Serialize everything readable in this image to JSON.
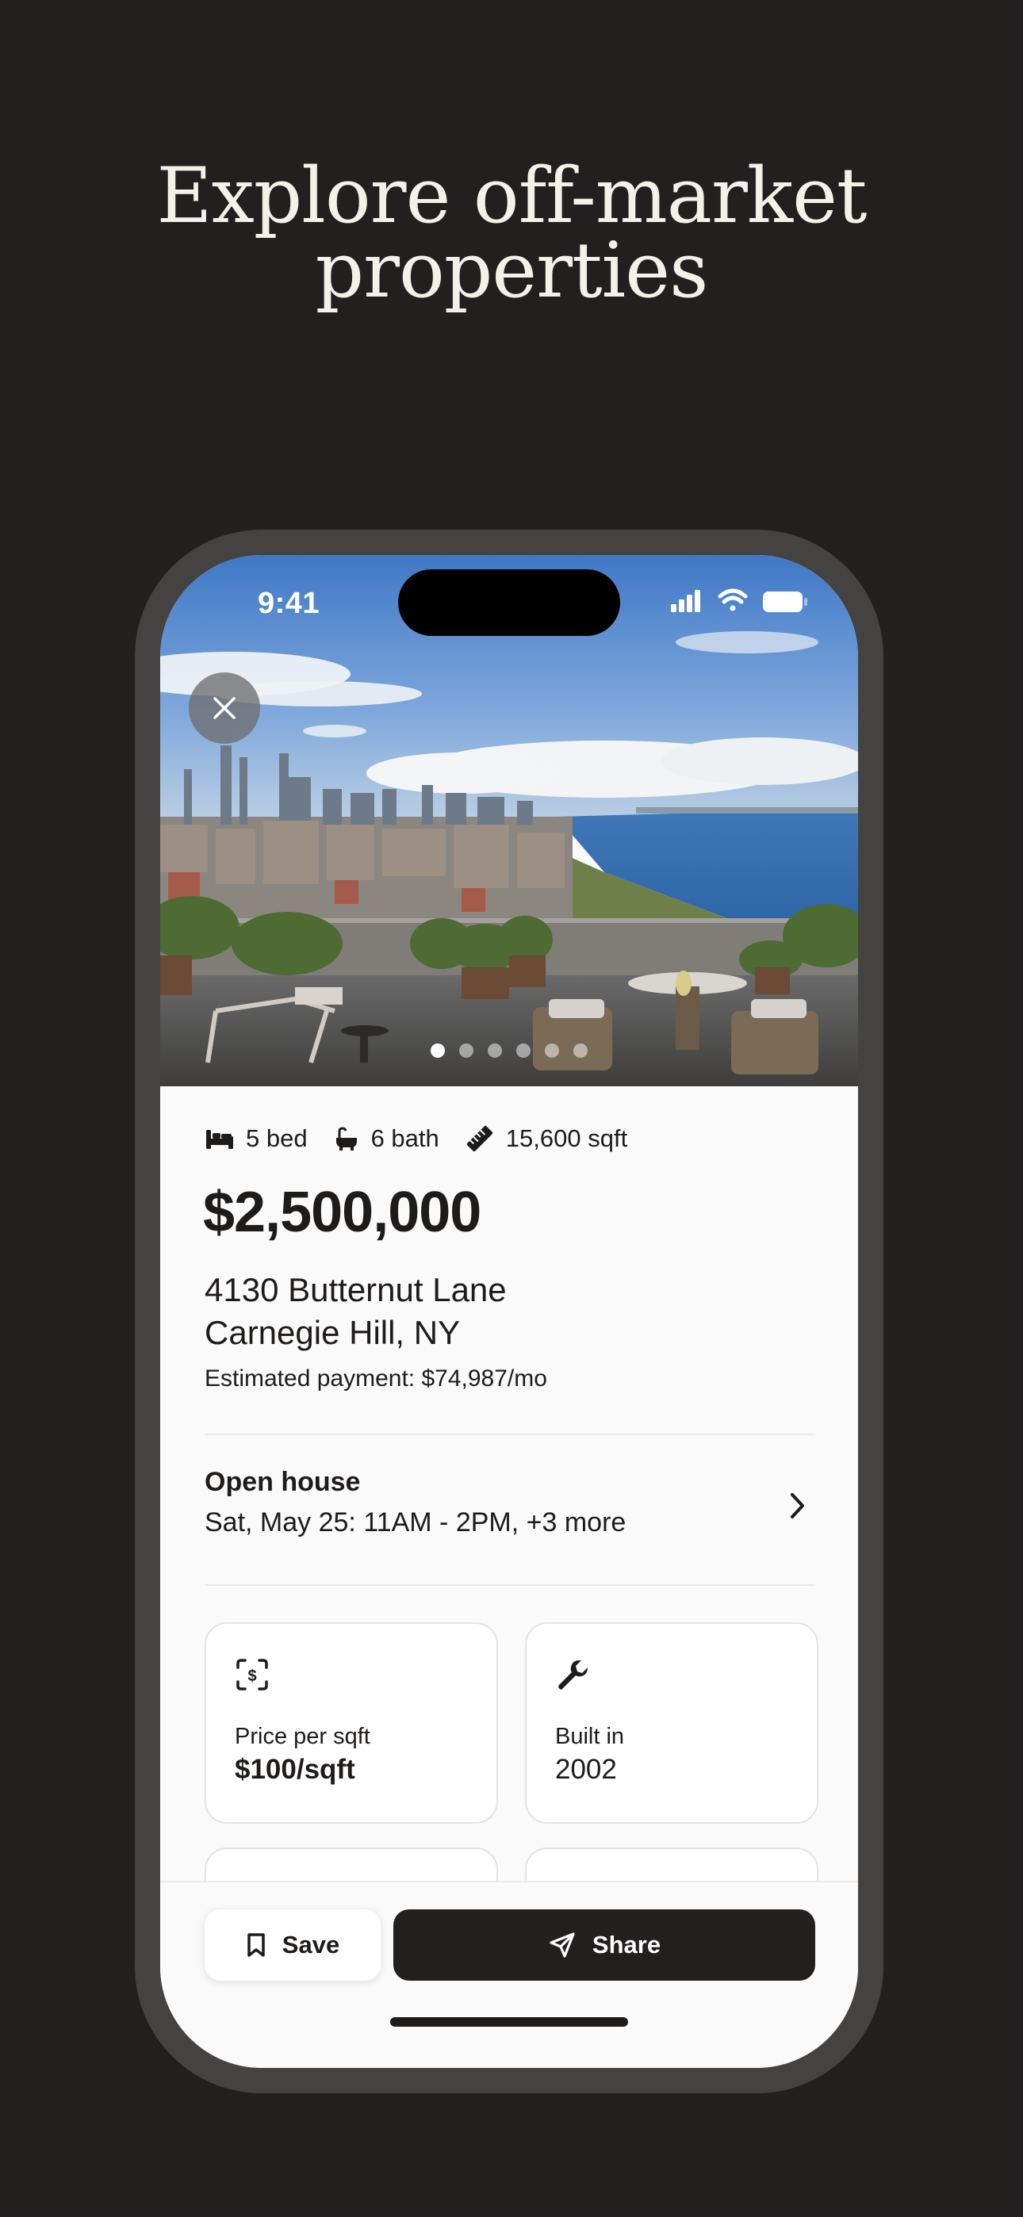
{
  "promo": {
    "headline_line1": "Explore off-market",
    "headline_line2": "properties"
  },
  "status_bar": {
    "time": "9:41",
    "icons": [
      "signal-icon",
      "wifi-icon",
      "battery-icon"
    ]
  },
  "gallery": {
    "photo_count": 6,
    "active_index": 0
  },
  "listing": {
    "beds": "5 bed",
    "baths": "6 bath",
    "area": "15,600 sqft",
    "price": "$2,500,000",
    "address_line1": "4130 Butternut Lane",
    "address_line2": "Carnegie Hill, NY",
    "estimated_payment": "Estimated payment: $74,987/mo"
  },
  "open_house": {
    "title": "Open house",
    "schedule": "Sat, May 25: 11AM - 2PM, +3 more"
  },
  "facts": [
    {
      "icon": "dollar-scan-icon",
      "label": "Price per sqft",
      "value": "$100/sqft"
    },
    {
      "icon": "wrench-icon",
      "label": "Built in",
      "value": "2002"
    }
  ],
  "actions": {
    "save_label": "Save",
    "share_label": "Share"
  },
  "colors": {
    "background": "#221f1f",
    "headline": "#f4f0ea",
    "text": "#1e1c1b",
    "share_button": "#221f1f"
  }
}
